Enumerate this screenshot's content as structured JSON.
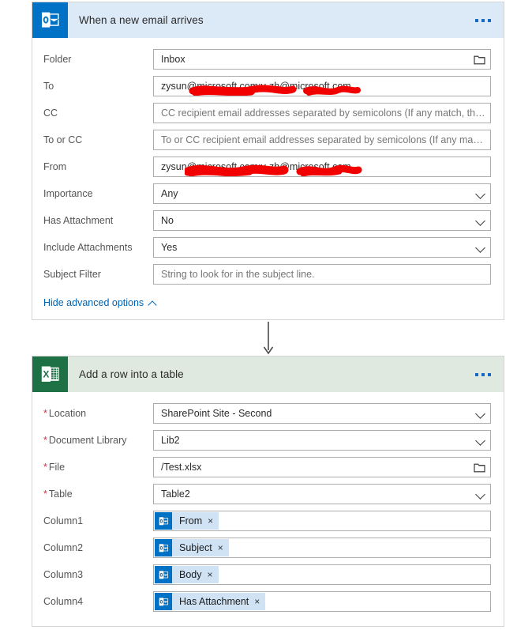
{
  "theme": {
    "outlook_blue": "#0072c6",
    "outlook_header_bg": "#dce9f7",
    "excel_green": "#1e7145",
    "excel_header_bg": "#dfe9df",
    "link_blue": "#0163b0",
    "required_red": "#c8344a",
    "redaction_red": "#f20000",
    "field_border": "#acacac",
    "canvas_bg": "#ffffff"
  },
  "trigger_card": {
    "icon": "outlook-icon",
    "title": "When a new email arrives",
    "menu_icon": "ellipsis-icon",
    "fields": [
      {
        "label": "Folder",
        "required": false,
        "value": "Inbox",
        "is_placeholder": false,
        "affordance": "folder-picker-icon"
      },
      {
        "label": "To",
        "required": false,
        "value": "zysun@microsoft.com;v-zh@microsoft.com",
        "value_visible_prefix": "zysun@",
        "value_visible_middle": "microsoft.com;v-zh",
        "value_visible_suffix": "microsoft.com",
        "is_placeholder": false,
        "redacted": true,
        "affordance": "none"
      },
      {
        "label": "CC",
        "required": false,
        "value": "CC recipient email addresses separated by semicolons (If any match, the trigg…",
        "is_placeholder": true,
        "affordance": "none"
      },
      {
        "label": "To or CC",
        "required": false,
        "value": "To or CC recipient email addresses separated by semicolons (If any match, th…",
        "is_placeholder": true,
        "affordance": "none"
      },
      {
        "label": "From",
        "required": false,
        "value": "zysun@microsoft.com;v-zh@microsoft.com",
        "is_placeholder": false,
        "redacted": true,
        "affordance": "none"
      },
      {
        "label": "Importance",
        "required": false,
        "value": "Any",
        "is_placeholder": false,
        "affordance": "chevron-down-icon"
      },
      {
        "label": "Has Attachment",
        "required": false,
        "value": "No",
        "is_placeholder": false,
        "affordance": "chevron-down-icon"
      },
      {
        "label": "Include Attachments",
        "required": false,
        "value": "Yes",
        "is_placeholder": false,
        "affordance": "chevron-down-icon"
      },
      {
        "label": "Subject Filter",
        "required": false,
        "value": "String to look for in the subject line.",
        "is_placeholder": true,
        "affordance": "none"
      }
    ],
    "advanced_options_link": "Hide advanced options"
  },
  "action_card": {
    "icon": "excel-icon",
    "title": "Add a row into a table",
    "menu_icon": "ellipsis-icon",
    "fields": [
      {
        "label": "Location",
        "required": true,
        "value": "SharePoint Site - Second",
        "is_placeholder": false,
        "affordance": "chevron-down-icon"
      },
      {
        "label": "Document Library",
        "required": true,
        "value": "Lib2",
        "is_placeholder": false,
        "affordance": "chevron-down-icon"
      },
      {
        "label": "File",
        "required": true,
        "value": "/Test.xlsx",
        "is_placeholder": false,
        "affordance": "folder-picker-icon"
      },
      {
        "label": "Table",
        "required": true,
        "value": "Table2",
        "is_placeholder": false,
        "affordance": "chevron-down-icon"
      },
      {
        "label": "Column1",
        "required": false,
        "token": {
          "icon": "outlook-icon",
          "label": "From",
          "remove": "×"
        },
        "affordance": "none"
      },
      {
        "label": "Column2",
        "required": false,
        "token": {
          "icon": "outlook-icon",
          "label": "Subject",
          "remove": "×"
        },
        "affordance": "none"
      },
      {
        "label": "Column3",
        "required": false,
        "token": {
          "icon": "outlook-icon",
          "label": "Body",
          "remove": "×"
        },
        "affordance": "none"
      },
      {
        "label": "Column4",
        "required": false,
        "token": {
          "icon": "outlook-icon",
          "label": "Has Attachment",
          "remove": "×"
        },
        "affordance": "none"
      }
    ]
  },
  "connector": {
    "icon": "down-arrow-icon"
  }
}
